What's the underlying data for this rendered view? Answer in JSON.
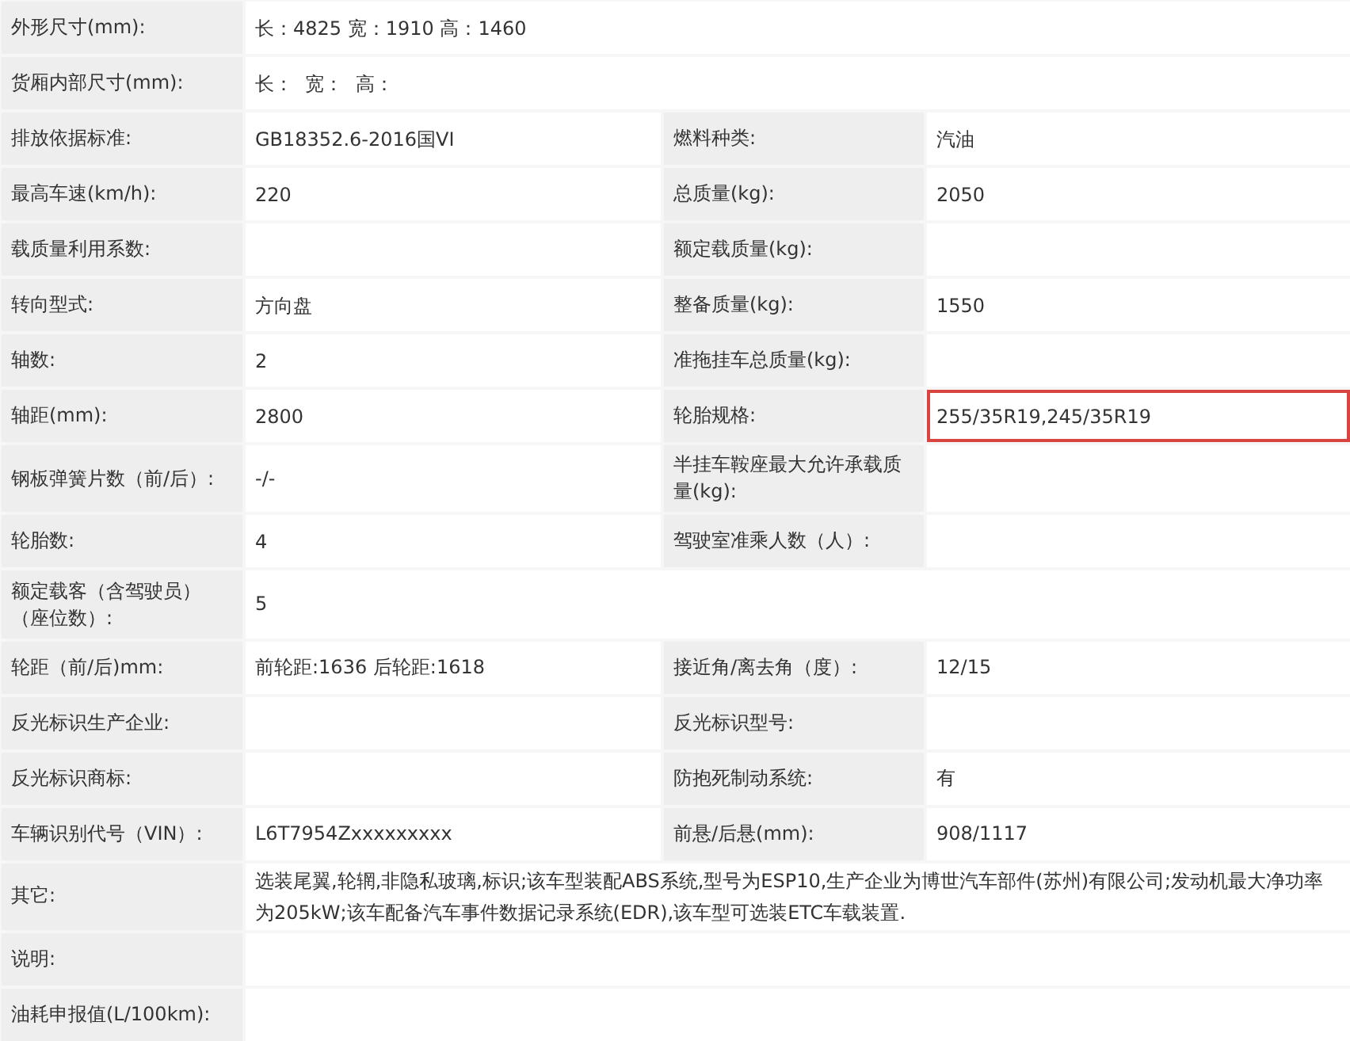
{
  "rows": [
    {
      "cells": [
        {
          "label": "外形尺寸(mm):",
          "value": "长：4825 宽：1910 高：1460",
          "highlighted": false
        }
      ]
    },
    {
      "cells": [
        {
          "label": "货厢内部尺寸(mm):",
          "value": "长：  宽：  高：",
          "highlighted": false
        }
      ]
    },
    {
      "cells": [
        {
          "label": "排放依据标准:",
          "value": "GB18352.6-2016国VI",
          "highlighted": false
        },
        {
          "label": "燃料种类:",
          "value": "汽油",
          "highlighted": false
        }
      ]
    },
    {
      "cells": [
        {
          "label": "最高车速(km/h):",
          "value": "220",
          "highlighted": false
        },
        {
          "label": "总质量(kg):",
          "value": "2050",
          "highlighted": false
        }
      ]
    },
    {
      "cells": [
        {
          "label": "载质量利用系数:",
          "highlighted": false
        },
        {
          "label": "额定载质量(kg):",
          "highlighted": false
        }
      ]
    },
    {
      "cells": [
        {
          "label": "转向型式:",
          "value": "方向盘",
          "highlighted": false
        },
        {
          "label": "整备质量(kg):",
          "value": "1550",
          "highlighted": false
        }
      ]
    },
    {
      "cells": [
        {
          "label": "轴数:",
          "value": "2",
          "highlighted": false
        },
        {
          "label": "准拖挂车总质量(kg):",
          "highlighted": false
        }
      ]
    },
    {
      "cells": [
        {
          "label": "轴距(mm):",
          "value": "2800",
          "highlighted": false
        },
        {
          "label": "轮胎规格:",
          "value": "255/35R19,245/35R19",
          "highlighted": true
        }
      ]
    },
    {
      "cells": [
        {
          "label": "钢板弹簧片数（前/后）:",
          "value": "-/-",
          "highlighted": false
        },
        {
          "label": "半挂车鞍座最大允许承载质量(kg):",
          "highlighted": false
        }
      ]
    },
    {
      "cells": [
        {
          "label": "轮胎数:",
          "value": "4",
          "highlighted": false
        },
        {
          "label": "驾驶室准乘人数（人）:",
          "highlighted": false
        }
      ]
    },
    {
      "cells": [
        {
          "label": "额定载客（含驾驶员）（座位数）:",
          "value": "5",
          "highlighted": false
        }
      ]
    },
    {
      "cells": [
        {
          "label": "轮距（前/后)mm:",
          "value": "前轮距:1636 后轮距:1618",
          "highlighted": false
        },
        {
          "label": "接近角/离去角（度）:",
          "value": "12/15",
          "highlighted": false
        }
      ]
    },
    {
      "cells": [
        {
          "label": "反光标识生产企业:",
          "highlighted": false
        },
        {
          "label": "反光标识型号:",
          "highlighted": false
        }
      ]
    },
    {
      "cells": [
        {
          "label": "反光标识商标:",
          "highlighted": false
        },
        {
          "label": "防抱死制动系统:",
          "value": "有",
          "highlighted": false
        }
      ]
    },
    {
      "cells": [
        {
          "label": "车辆识别代号（VIN）:",
          "value": "L6T7954Zxxxxxxxxx",
          "highlighted": false
        },
        {
          "label": "前悬/后悬(mm):",
          "value": "908/1117",
          "highlighted": false
        }
      ]
    },
    {
      "cells": [
        {
          "label": "其它:",
          "value": "选装尾翼,轮辋,非隐私玻璃,标识;该车型装配ABS系统,型号为ESP10,生产企业为博世汽车部件(苏州)有限公司;发动机最大净功率为205kW;该车配备汽车事件数据记录系统(EDR),该车型可选装ETC车载装置.",
          "highlighted": false
        }
      ]
    },
    {
      "cells": [
        {
          "label": "说明:",
          "highlighted": false
        }
      ]
    },
    {
      "cells": [
        {
          "label": "油耗申报值(L/100km):",
          "highlighted": false
        }
      ]
    }
  ]
}
